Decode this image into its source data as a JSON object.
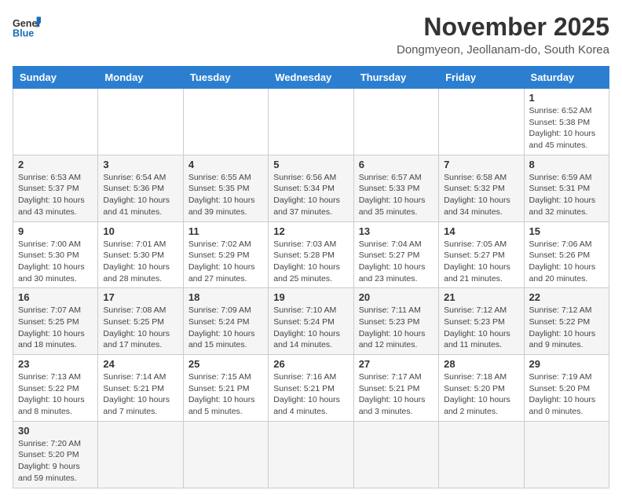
{
  "logo": {
    "general": "General",
    "blue": "Blue"
  },
  "header": {
    "month_year": "November 2025",
    "location": "Dongmyeon, Jeollanam-do, South Korea"
  },
  "columns": [
    "Sunday",
    "Monday",
    "Tuesday",
    "Wednesday",
    "Thursday",
    "Friday",
    "Saturday"
  ],
  "weeks": [
    [
      {
        "day": "",
        "info": ""
      },
      {
        "day": "",
        "info": ""
      },
      {
        "day": "",
        "info": ""
      },
      {
        "day": "",
        "info": ""
      },
      {
        "day": "",
        "info": ""
      },
      {
        "day": "",
        "info": ""
      },
      {
        "day": "1",
        "info": "Sunrise: 6:52 AM\nSunset: 5:38 PM\nDaylight: 10 hours and 45 minutes."
      }
    ],
    [
      {
        "day": "2",
        "info": "Sunrise: 6:53 AM\nSunset: 5:37 PM\nDaylight: 10 hours and 43 minutes."
      },
      {
        "day": "3",
        "info": "Sunrise: 6:54 AM\nSunset: 5:36 PM\nDaylight: 10 hours and 41 minutes."
      },
      {
        "day": "4",
        "info": "Sunrise: 6:55 AM\nSunset: 5:35 PM\nDaylight: 10 hours and 39 minutes."
      },
      {
        "day": "5",
        "info": "Sunrise: 6:56 AM\nSunset: 5:34 PM\nDaylight: 10 hours and 37 minutes."
      },
      {
        "day": "6",
        "info": "Sunrise: 6:57 AM\nSunset: 5:33 PM\nDaylight: 10 hours and 35 minutes."
      },
      {
        "day": "7",
        "info": "Sunrise: 6:58 AM\nSunset: 5:32 PM\nDaylight: 10 hours and 34 minutes."
      },
      {
        "day": "8",
        "info": "Sunrise: 6:59 AM\nSunset: 5:31 PM\nDaylight: 10 hours and 32 minutes."
      }
    ],
    [
      {
        "day": "9",
        "info": "Sunrise: 7:00 AM\nSunset: 5:30 PM\nDaylight: 10 hours and 30 minutes."
      },
      {
        "day": "10",
        "info": "Sunrise: 7:01 AM\nSunset: 5:30 PM\nDaylight: 10 hours and 28 minutes."
      },
      {
        "day": "11",
        "info": "Sunrise: 7:02 AM\nSunset: 5:29 PM\nDaylight: 10 hours and 27 minutes."
      },
      {
        "day": "12",
        "info": "Sunrise: 7:03 AM\nSunset: 5:28 PM\nDaylight: 10 hours and 25 minutes."
      },
      {
        "day": "13",
        "info": "Sunrise: 7:04 AM\nSunset: 5:27 PM\nDaylight: 10 hours and 23 minutes."
      },
      {
        "day": "14",
        "info": "Sunrise: 7:05 AM\nSunset: 5:27 PM\nDaylight: 10 hours and 21 minutes."
      },
      {
        "day": "15",
        "info": "Sunrise: 7:06 AM\nSunset: 5:26 PM\nDaylight: 10 hours and 20 minutes."
      }
    ],
    [
      {
        "day": "16",
        "info": "Sunrise: 7:07 AM\nSunset: 5:25 PM\nDaylight: 10 hours and 18 minutes."
      },
      {
        "day": "17",
        "info": "Sunrise: 7:08 AM\nSunset: 5:25 PM\nDaylight: 10 hours and 17 minutes."
      },
      {
        "day": "18",
        "info": "Sunrise: 7:09 AM\nSunset: 5:24 PM\nDaylight: 10 hours and 15 minutes."
      },
      {
        "day": "19",
        "info": "Sunrise: 7:10 AM\nSunset: 5:24 PM\nDaylight: 10 hours and 14 minutes."
      },
      {
        "day": "20",
        "info": "Sunrise: 7:11 AM\nSunset: 5:23 PM\nDaylight: 10 hours and 12 minutes."
      },
      {
        "day": "21",
        "info": "Sunrise: 7:12 AM\nSunset: 5:23 PM\nDaylight: 10 hours and 11 minutes."
      },
      {
        "day": "22",
        "info": "Sunrise: 7:12 AM\nSunset: 5:22 PM\nDaylight: 10 hours and 9 minutes."
      }
    ],
    [
      {
        "day": "23",
        "info": "Sunrise: 7:13 AM\nSunset: 5:22 PM\nDaylight: 10 hours and 8 minutes."
      },
      {
        "day": "24",
        "info": "Sunrise: 7:14 AM\nSunset: 5:21 PM\nDaylight: 10 hours and 7 minutes."
      },
      {
        "day": "25",
        "info": "Sunrise: 7:15 AM\nSunset: 5:21 PM\nDaylight: 10 hours and 5 minutes."
      },
      {
        "day": "26",
        "info": "Sunrise: 7:16 AM\nSunset: 5:21 PM\nDaylight: 10 hours and 4 minutes."
      },
      {
        "day": "27",
        "info": "Sunrise: 7:17 AM\nSunset: 5:21 PM\nDaylight: 10 hours and 3 minutes."
      },
      {
        "day": "28",
        "info": "Sunrise: 7:18 AM\nSunset: 5:20 PM\nDaylight: 10 hours and 2 minutes."
      },
      {
        "day": "29",
        "info": "Sunrise: 7:19 AM\nSunset: 5:20 PM\nDaylight: 10 hours and 0 minutes."
      }
    ],
    [
      {
        "day": "30",
        "info": "Sunrise: 7:20 AM\nSunset: 5:20 PM\nDaylight: 9 hours and 59 minutes."
      },
      {
        "day": "",
        "info": ""
      },
      {
        "day": "",
        "info": ""
      },
      {
        "day": "",
        "info": ""
      },
      {
        "day": "",
        "info": ""
      },
      {
        "day": "",
        "info": ""
      },
      {
        "day": "",
        "info": ""
      }
    ]
  ]
}
